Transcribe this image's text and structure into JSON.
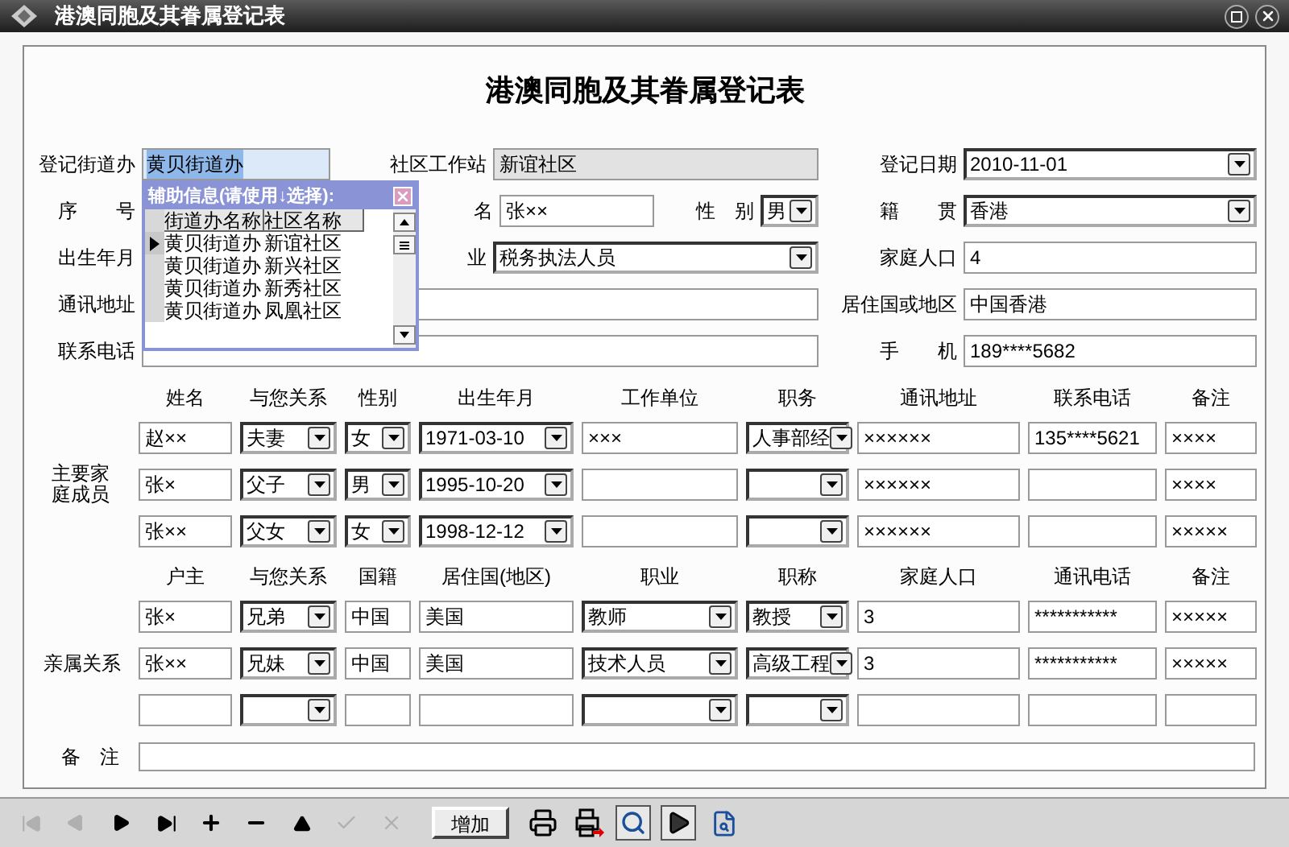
{
  "window": {
    "title": "港澳同胞及其眷属登记表"
  },
  "form": {
    "title": "港澳同胞及其眷属登记表",
    "top_rows": [
      {
        "groups": [
          {
            "items": [
              {
                "label": "登记街道办",
                "field": {
                  "kind": "highlighted",
                  "value": "黄贝街道办"
                }
              }
            ]
          },
          {
            "items": [
              {
                "label": "社区工作站",
                "field": {
                  "kind": "readonly",
                  "value": "新谊社区"
                }
              }
            ]
          },
          {
            "items": [
              {
                "label": "登记日期",
                "field": {
                  "kind": "select",
                  "value": "2010-11-01"
                }
              }
            ]
          }
        ]
      },
      {
        "groups": [
          {
            "items": [
              {
                "label": "序　　号"
              }
            ]
          },
          {
            "items": [
              {
                "label": "名",
                "field": {
                  "kind": "text",
                  "value": "张××"
                }
              },
              {
                "label": "性　别",
                "field": {
                  "kind": "select",
                  "value": "男"
                }
              }
            ]
          },
          {
            "items": [
              {
                "label": "籍　　贯",
                "field": {
                  "kind": "select",
                  "value": "香港"
                }
              }
            ]
          }
        ]
      },
      {
        "groups": [
          {
            "items": [
              {
                "label": "出生年月"
              }
            ]
          },
          {
            "items": [
              {
                "label": "业",
                "field": {
                  "kind": "select",
                  "value": "税务执法人员"
                }
              }
            ]
          },
          {
            "items": [
              {
                "label": "家庭人口",
                "field": {
                  "kind": "text",
                  "value": "4"
                }
              }
            ]
          }
        ]
      },
      {
        "groups": [
          {
            "items": [
              {
                "label": "通讯地址",
                "field": {
                  "kind": "text"
                }
              }
            ]
          },
          {
            "items": [
              {
                "label": "居住国或地区",
                "field": {
                  "kind": "text",
                  "value": "中国香港"
                }
              }
            ]
          }
        ]
      },
      {
        "groups": [
          {
            "items": [
              {
                "label": "联系电话",
                "field": {
                  "kind": "text"
                }
              }
            ]
          },
          {
            "items": [
              {
                "label": "手　　机",
                "field": {
                  "kind": "text",
                  "value": "189****5682"
                }
              }
            ]
          }
        ]
      }
    ],
    "family": {
      "label": "主要家庭成员",
      "columns": [
        "姓名",
        "与您关系",
        "性别",
        "出生年月",
        "工作单位",
        "职务",
        "通讯地址",
        "联系电话",
        "备注"
      ],
      "rows": [
        [
          {
            "kind": "text",
            "value": "赵××"
          },
          {
            "kind": "select",
            "value": "夫妻"
          },
          {
            "kind": "select",
            "value": "女"
          },
          {
            "kind": "select",
            "value": "1971-03-10"
          },
          {
            "kind": "text",
            "value": "×××"
          },
          {
            "kind": "select",
            "value": "人事部经"
          },
          {
            "kind": "text",
            "value": "××××××"
          },
          {
            "kind": "text",
            "value": "135****5621"
          },
          {
            "kind": "text",
            "value": "××××"
          }
        ],
        [
          {
            "kind": "text",
            "value": "张×"
          },
          {
            "kind": "select",
            "value": "父子"
          },
          {
            "kind": "select",
            "value": "男"
          },
          {
            "kind": "select",
            "value": "1995-10-20"
          },
          {
            "kind": "text"
          },
          {
            "kind": "select"
          },
          {
            "kind": "text",
            "value": "××××××"
          },
          {
            "kind": "text"
          },
          {
            "kind": "text",
            "value": "××××"
          }
        ],
        [
          {
            "kind": "text",
            "value": "张××"
          },
          {
            "kind": "select",
            "value": "父女"
          },
          {
            "kind": "select",
            "value": "女"
          },
          {
            "kind": "select",
            "value": "1998-12-12"
          },
          {
            "kind": "text"
          },
          {
            "kind": "select"
          },
          {
            "kind": "text",
            "value": "××××××"
          },
          {
            "kind": "text"
          },
          {
            "kind": "text",
            "value": "×××××"
          }
        ]
      ]
    },
    "relatives": {
      "label": "亲属关系",
      "columns": [
        "户主",
        "与您关系",
        "国籍",
        "居住国(地区)",
        "职业",
        "职称",
        "家庭人口",
        "通讯电话",
        "备注"
      ],
      "rows": [
        [
          {
            "kind": "text",
            "value": "张×"
          },
          {
            "kind": "select",
            "value": "兄弟"
          },
          {
            "kind": "text",
            "value": "中国"
          },
          {
            "kind": "text",
            "value": "美国"
          },
          {
            "kind": "select",
            "value": "教师"
          },
          {
            "kind": "select",
            "value": "教授"
          },
          {
            "kind": "text",
            "value": "3"
          },
          {
            "kind": "text",
            "value": "***********"
          },
          {
            "kind": "text",
            "value": "×××××"
          }
        ],
        [
          {
            "kind": "text",
            "value": "张××"
          },
          {
            "kind": "select",
            "value": "兄妹"
          },
          {
            "kind": "text",
            "value": "中国"
          },
          {
            "kind": "text",
            "value": "美国"
          },
          {
            "kind": "select",
            "value": "技术人员"
          },
          {
            "kind": "select",
            "value": "高级工程"
          },
          {
            "kind": "text",
            "value": "3"
          },
          {
            "kind": "text",
            "value": "***********"
          },
          {
            "kind": "text",
            "value": "×××××"
          }
        ],
        [
          {
            "kind": "text"
          },
          {
            "kind": "select"
          },
          {
            "kind": "text"
          },
          {
            "kind": "text"
          },
          {
            "kind": "select"
          },
          {
            "kind": "select"
          },
          {
            "kind": "text"
          },
          {
            "kind": "text"
          },
          {
            "kind": "text"
          }
        ]
      ]
    },
    "remarks": {
      "label": "备　注"
    }
  },
  "popup": {
    "title": "辅助信息(请使用↓选择):",
    "columns": [
      "街道办名称",
      "社区名称"
    ],
    "rows": [
      {
        "cells": [
          "黄贝街道办",
          "新谊社区"
        ],
        "selected": true
      },
      {
        "cells": [
          "黄贝街道办",
          "新兴社区"
        ],
        "selected": false
      },
      {
        "cells": [
          "黄贝街道办",
          "新秀社区"
        ],
        "selected": false
      },
      {
        "cells": [
          "黄贝街道办",
          "凤凰社区"
        ],
        "selected": false
      }
    ]
  },
  "toolbar": [
    {
      "kind": "first",
      "disabled": true,
      "pressed": false
    },
    {
      "kind": "prev",
      "disabled": true,
      "pressed": false
    },
    {
      "kind": "next",
      "disabled": false,
      "pressed": false
    },
    {
      "kind": "last",
      "disabled": false,
      "pressed": false
    },
    {
      "kind": "add",
      "disabled": false,
      "pressed": false
    },
    {
      "kind": "remove",
      "disabled": false,
      "pressed": false
    },
    {
      "kind": "up",
      "disabled": false,
      "pressed": false
    },
    {
      "kind": "confirm",
      "disabled": true,
      "pressed": false
    },
    {
      "kind": "cancel",
      "disabled": true,
      "pressed": false
    },
    {
      "kind": "text",
      "label": "增加",
      "disabled": false,
      "pressed": false
    },
    {
      "kind": "print",
      "disabled": false,
      "pressed": false
    },
    {
      "kind": "print-export",
      "disabled": false,
      "pressed": false
    },
    {
      "kind": "preview",
      "disabled": false,
      "pressed": true
    },
    {
      "kind": "run",
      "disabled": false,
      "pressed": true
    },
    {
      "kind": "find",
      "disabled": false,
      "pressed": false
    }
  ]
}
